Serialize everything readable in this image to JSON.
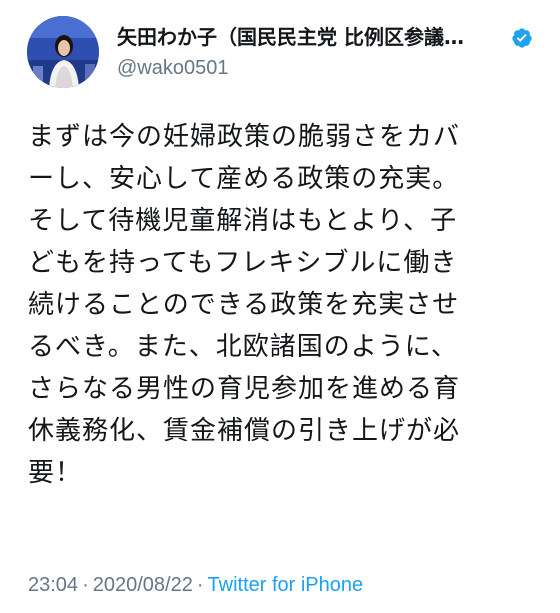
{
  "tweet": {
    "author": {
      "display_name": "矢田わか子（国民民主党 比例区参議…",
      "handle": "@wako0501",
      "verified": true,
      "avatar_icon": "profile-photo",
      "verified_icon": "verified-badge-icon",
      "verified_color": "#1da1f2"
    },
    "body_lines": [
      "まずは今の妊婦政策の脆弱さをカバ",
      "ーし、安心して産める政策の充実。",
      "そして待機児童解消はもとより、子",
      "どもを持ってもフレキシブルに働き",
      "続けることのできる政策を充実させ",
      "るべき。また、北欧諸国のように、",
      "さらなる男性の育児参加を進める育",
      "休義務化、賃金補償の引き上げが必",
      "要！"
    ],
    "meta": {
      "time": "23:04",
      "separator1": "·",
      "date": "2020/08/22",
      "separator2": "·",
      "source": "Twitter for iPhone"
    }
  },
  "colors": {
    "text": "#14171a",
    "secondary": "#657786",
    "link": "#1da1f2"
  }
}
